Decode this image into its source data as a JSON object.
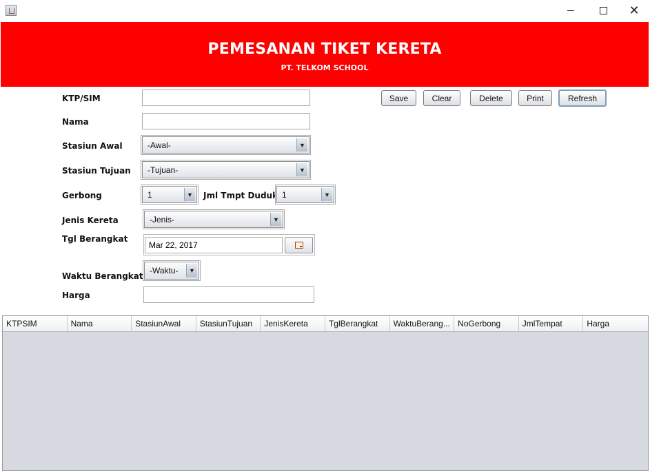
{
  "window": {
    "minimize": "—",
    "maximize": "",
    "close": "✕"
  },
  "header": {
    "title": "PEMESANAN TIKET KERETA",
    "subtitle": "PT. TELKOM SCHOOL",
    "color": "#ff0000"
  },
  "form": {
    "ktp_label": "KTP/SIM",
    "ktp_value": "",
    "nama_label": "Nama",
    "nama_value": "",
    "stasiun_awal_label": "Stasiun Awal",
    "stasiun_awal_value": "-Awal-",
    "stasiun_tujuan_label": "Stasiun Tujuan",
    "stasiun_tujuan_value": "-Tujuan-",
    "gerbong_label": "Gerbong",
    "gerbong_value": "1",
    "jml_label": "Jml Tmpt Duduk",
    "jml_value": "1",
    "jenis_label": "Jenis Kereta",
    "jenis_value": "-Jenis-",
    "tgl_label": "Tgl Berangkat",
    "tgl_value": "Mar 22, 2017",
    "waktu_label": "Waktu Berangkat",
    "waktu_value": "-Waktu-",
    "harga_label": "Harga",
    "harga_value": ""
  },
  "buttons": {
    "save": "Save",
    "clear": "Clear",
    "delete": "Delete",
    "print": "Print",
    "refresh": "Refresh"
  },
  "table": {
    "columns": [
      "KTPSIM",
      "Nama",
      "StasiunAwal",
      "StasiunTujuan",
      "JenisKereta",
      "TglBerangkat",
      "WaktuBerang...",
      "NoGerbong",
      "JmlTempat",
      "Harga"
    ],
    "rows": []
  }
}
